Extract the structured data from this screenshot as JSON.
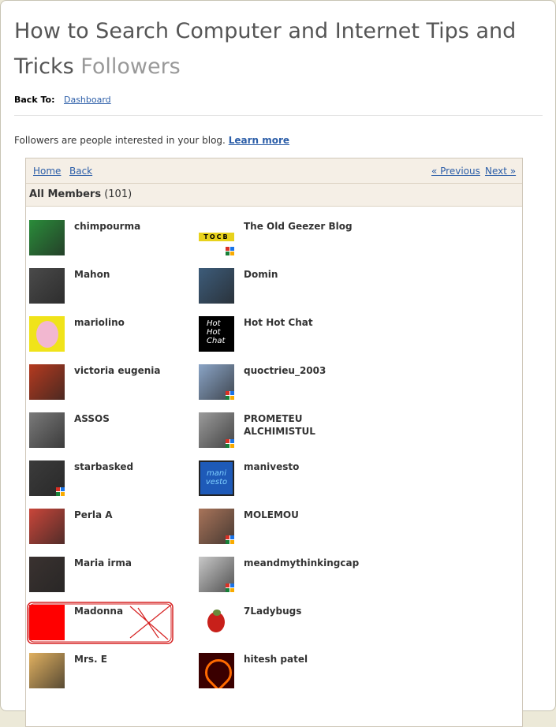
{
  "header": {
    "title_main": "How to Search Computer and Internet Tips and Tricks",
    "title_sub": "Followers"
  },
  "back": {
    "label": "Back To:",
    "link": "Dashboard"
  },
  "intro": {
    "text": "Followers are people interested in your blog.",
    "learn_more": "Learn more"
  },
  "nav": {
    "home": "Home",
    "back": "Back",
    "previous": "« Previous",
    "next": "Next »"
  },
  "members_header": {
    "label": "All Members",
    "count": "(101)"
  },
  "members": [
    {
      "name": "chimpourma",
      "color": "#2a8c3a"
    },
    {
      "name": "The Old Geezer Blog",
      "color": "#e8d21c"
    },
    {
      "name": "Mahon",
      "color": "#4a4a4a"
    },
    {
      "name": "Domin",
      "color": "#3d5c7a"
    },
    {
      "name": "mariolino",
      "color": "#f0e31a"
    },
    {
      "name": "Hot Hot Chat",
      "color": "#000000"
    },
    {
      "name": "victoria eugenia",
      "color": "#b53a1f"
    },
    {
      "name": "quoctrieu_2003",
      "color": "#8aa4c6"
    },
    {
      "name": "ASSOS",
      "color": "#7a7a7a"
    },
    {
      "name": "PROMETEU ALCHIMISTUL",
      "color": "#9b9b9b"
    },
    {
      "name": "starbasked",
      "color": "#3b3b3b"
    },
    {
      "name": "manivesto",
      "color": "#1e5ab8"
    },
    {
      "name": "Perla A",
      "color": "#c9463a"
    },
    {
      "name": "MOLEMOU",
      "color": "#a8745a"
    },
    {
      "name": "Maria irma",
      "color": "#3a3230"
    },
    {
      "name": "meandmythinkingcap",
      "color": "#c8c8c8"
    },
    {
      "name": "Madonna",
      "color": "#ff0000"
    },
    {
      "name": "7Ladybugs",
      "color": "#d8d8d8"
    },
    {
      "name": "Mrs. E",
      "color": "#e0b060"
    },
    {
      "name": "hitesh patel",
      "color": "#c11"
    }
  ],
  "hot_chat_text": "Hot Hot Chat",
  "ocb_text": "TOCB",
  "mani_text": "mani vesto"
}
